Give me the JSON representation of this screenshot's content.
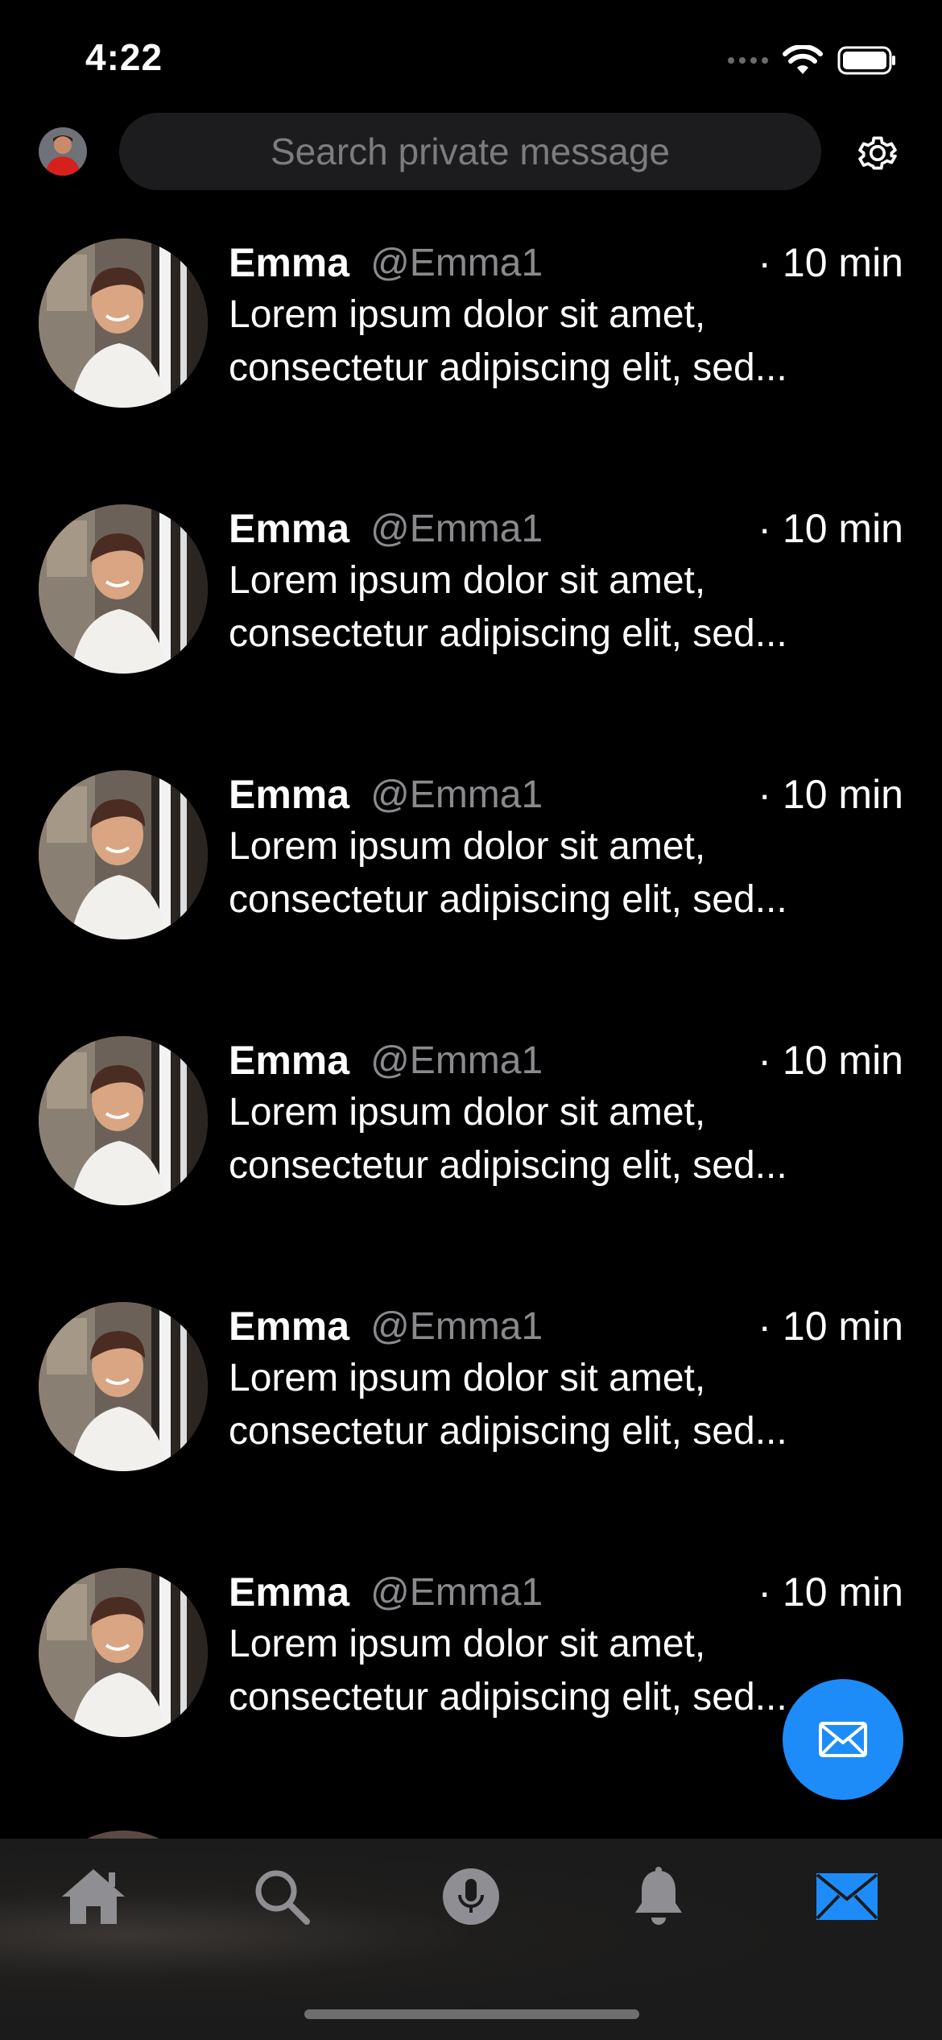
{
  "status_bar": {
    "time": "4:22"
  },
  "header": {
    "search_placeholder": "Search private message",
    "avatar_icon": "profile-avatar",
    "settings_icon": "gear-icon"
  },
  "messages": [
    {
      "name": "Emma",
      "handle": "@Emma1",
      "time": "· 10 min",
      "text": "Lorem ipsum dolor sit amet, consectetur adipiscing elit, sed..."
    },
    {
      "name": "Emma",
      "handle": "@Emma1",
      "time": "· 10 min",
      "text": "Lorem ipsum dolor sit amet, consectetur adipiscing elit, sed..."
    },
    {
      "name": "Emma",
      "handle": "@Emma1",
      "time": "· 10 min",
      "text": "Lorem ipsum dolor sit amet, consectetur adipiscing elit, sed..."
    },
    {
      "name": "Emma",
      "handle": "@Emma1",
      "time": "· 10 min",
      "text": "Lorem ipsum dolor sit amet, consectetur adipiscing elit, sed..."
    },
    {
      "name": "Emma",
      "handle": "@Emma1",
      "time": "· 10 min",
      "text": "Lorem ipsum dolor sit amet, consectetur adipiscing elit, sed..."
    },
    {
      "name": "Emma",
      "handle": "@Emma1",
      "time": "· 10 min",
      "text": "Lorem ipsum dolor sit amet, consectetur adipiscing elit, sed..."
    }
  ],
  "fab": {
    "icon": "mail-icon"
  },
  "tab_bar": {
    "tabs": [
      {
        "icon": "home-icon",
        "active": false
      },
      {
        "icon": "search-icon",
        "active": false
      },
      {
        "icon": "microphone-icon",
        "active": false
      },
      {
        "icon": "bell-icon",
        "active": false
      },
      {
        "icon": "mail-icon",
        "active": true
      }
    ]
  },
  "colors": {
    "background": "#000000",
    "accent": "#1D8CF8",
    "inactive_icon": "#8E8E93",
    "search_bg": "#1C1C1E",
    "secondary_text": "#8A8A8E"
  }
}
